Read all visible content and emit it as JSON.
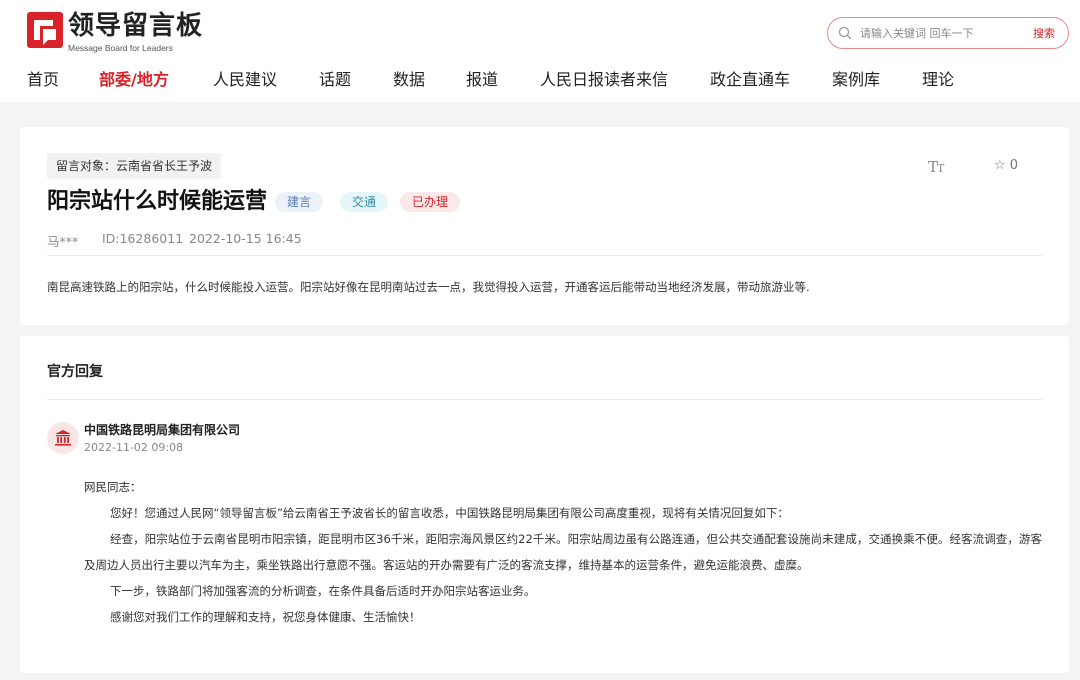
{
  "header": {
    "logo_title": "领导留言板",
    "logo_subtitle": "Message Board for Leaders",
    "brand_color": "#d8232a",
    "search": {
      "placeholder": "请输入关键词 回车一下",
      "button_label": "搜索"
    },
    "nav": [
      {
        "label": "首页",
        "active": false
      },
      {
        "label": "部委/地方",
        "active": true
      },
      {
        "label": "人民建议",
        "active": false
      },
      {
        "label": "话题",
        "active": false
      },
      {
        "label": "数据",
        "active": false
      },
      {
        "label": "报道",
        "active": false
      },
      {
        "label": "人民日报读者来信",
        "active": false
      },
      {
        "label": "政企直通车",
        "active": false
      },
      {
        "label": "案例库",
        "active": false
      },
      {
        "label": "理论",
        "active": false
      }
    ]
  },
  "post": {
    "target": "留言对象：云南省省长王予波",
    "title": "阳宗站什么时候能运营",
    "tags": [
      "建言",
      "交通",
      "已办理"
    ],
    "font_size_icon": "TT",
    "favorite_count": "0",
    "author": "马***",
    "id": "ID:16286011",
    "date": "2022-10-15 16:45",
    "body": "南昆高速铁路上的阳宗站，什么时候能投入运营。阳宗站好像在昆明南站过去一点，我觉得投入运营，开通客运后能带动当地经济发展，带动旅游业等."
  },
  "reply": {
    "heading": "官方回复",
    "org": "中国铁路昆明局集团有限公司",
    "date": "2022-11-02 09:08",
    "greeting": "网民同志：",
    "paragraphs": [
      "您好！您通过人民网“领导留言板”给云南省王予波省长的留言收悉，中国铁路昆明局集团有限公司高度重视，现将有关情况回复如下：",
      "经查，阳宗站位于云南省昆明市阳宗镇，距昆明市区36千米，距阳宗海风景区约22千米。阳宗站周边虽有公路连通，但公共交通配套设施尚未建成，交通换乘不便。经客流调查，游客及周边人员出行主要以汽车为主，乘坐铁路出行意愿不强。客运站的开办需要有广泛的客流支撑，维持基本的运营条件，避免运能浪费、虚糜。",
      "下一步，铁路部门将加强客流的分析调查，在条件具备后适时开办阳宗站客运业务。",
      "感谢您对我们工作的理解和支持，祝您身体健康、生活愉快！"
    ]
  }
}
